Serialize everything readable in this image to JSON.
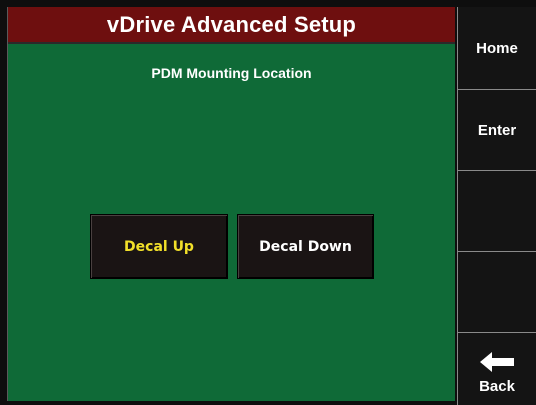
{
  "header": {
    "title": "vDrive Advanced Setup"
  },
  "screen": {
    "subtitle": "PDM Mounting Location",
    "options": [
      {
        "label": "Decal Up",
        "selected": true
      },
      {
        "label": "Decal Down",
        "selected": false
      }
    ]
  },
  "sidebar": {
    "home_label": "Home",
    "enter_label": "Enter",
    "back_label": "Back",
    "back_icon": "back-arrow-icon"
  },
  "colors": {
    "title_bar": "#6e0f0f",
    "background": "#0f6a37",
    "selected_text": "#f2e02a"
  }
}
